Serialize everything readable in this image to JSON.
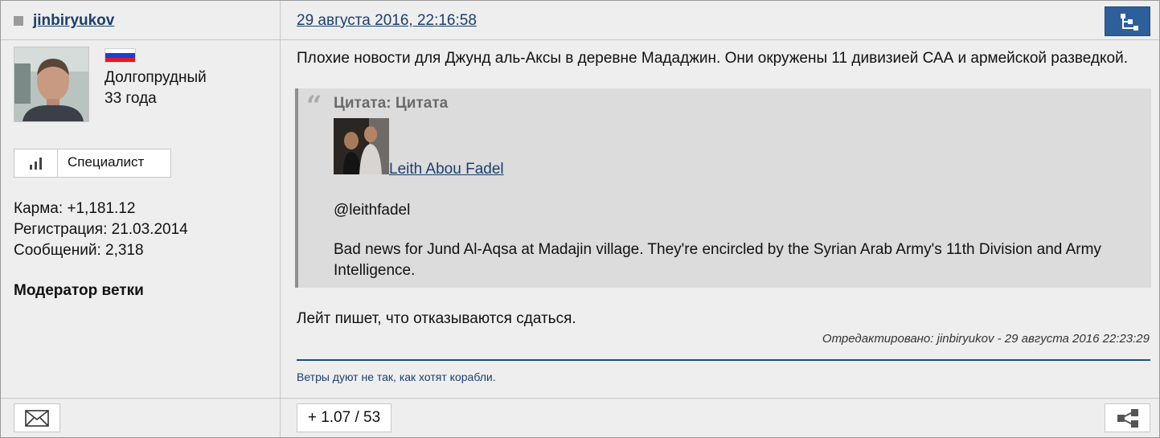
{
  "header": {
    "username": "jinbiryukov",
    "post_date": "29 августа 2016, 22:16:58",
    "reply_tree_icon": "reply-tree-icon"
  },
  "user": {
    "flag_colors": [
      "#ffffff",
      "#1d3fd1",
      "#e01b22"
    ],
    "city": "Долгопрудный",
    "age": "33 года",
    "rank_icon": "signal-bars-icon",
    "rank": "Специалист",
    "karma": "Карма: +1,181.12",
    "registered": "Регистрация: 21.03.2014",
    "messages": "Сообщений: 2,318",
    "role": "Модератор ветки"
  },
  "post": {
    "text": "Плохие новости для Джунд аль-Аксы в деревне Мададжин. Они окружены 11 дивизией САА и армейской разведкой.",
    "quote": {
      "mark": "“",
      "title": "Цитата: Цитата",
      "author": "Leith Abou Fadel",
      "handle": "@leithfadel",
      "text": "Bad news for Jund Al-Aqsa at Madajin village. They're encircled by the Syrian Arab Army's 11th Division and Army Intelligence."
    },
    "after_quote": "Лейт пишет, что отказываются сдаться.",
    "edited": "Отредактировано: jinbiryukov - 29 августа 2016 22:23:29",
    "signature": "Ветры дуют не так, как хотят корабли."
  },
  "footer": {
    "mail_icon": "envelope-icon",
    "rating": "+ 1.07 / 53",
    "share_icon": "share-icon"
  },
  "colors": {
    "link": "#1b3f6e",
    "accent": "#2d5f9a",
    "quote_bg": "#dcdcdc",
    "panel_bg": "#eeeeee"
  }
}
